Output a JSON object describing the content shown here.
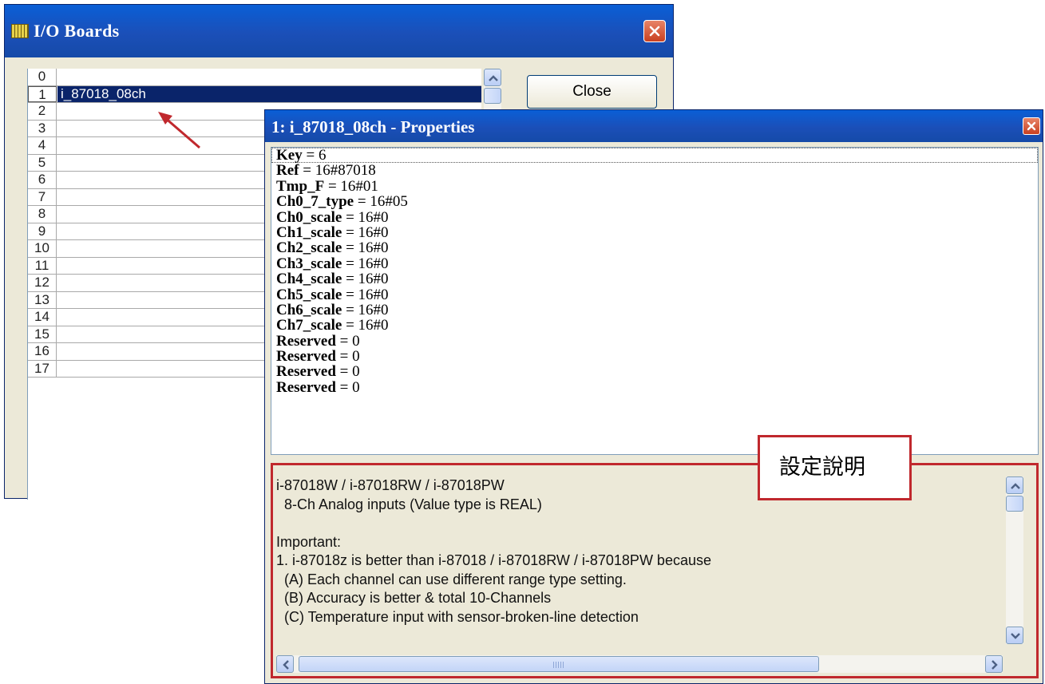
{
  "io_window": {
    "title": "I/O Boards",
    "close_label": "Close",
    "rows": [
      {
        "num": "0",
        "name": ""
      },
      {
        "num": "1",
        "name": "i_87018_08ch",
        "selected": true
      },
      {
        "num": "2",
        "name": ""
      },
      {
        "num": "3",
        "name": ""
      },
      {
        "num": "4",
        "name": ""
      },
      {
        "num": "5",
        "name": ""
      },
      {
        "num": "6",
        "name": ""
      },
      {
        "num": "7",
        "name": ""
      },
      {
        "num": "8",
        "name": ""
      },
      {
        "num": "9",
        "name": ""
      },
      {
        "num": "10",
        "name": ""
      },
      {
        "num": "11",
        "name": ""
      },
      {
        "num": "12",
        "name": ""
      },
      {
        "num": "13",
        "name": ""
      },
      {
        "num": "14",
        "name": ""
      },
      {
        "num": "15",
        "name": ""
      },
      {
        "num": "16",
        "name": ""
      },
      {
        "num": "17",
        "name": ""
      }
    ]
  },
  "properties_window": {
    "title": "1: i_87018_08ch - Properties",
    "properties": [
      {
        "key": "Key",
        "value": "6"
      },
      {
        "key": "Ref",
        "value": "16#87018"
      },
      {
        "key": "Tmp_F",
        "value": "16#01"
      },
      {
        "key": "Ch0_7_type",
        "value": "16#05"
      },
      {
        "key": "Ch0_scale",
        "value": "16#0"
      },
      {
        "key": "Ch1_scale",
        "value": "16#0"
      },
      {
        "key": "Ch2_scale",
        "value": "16#0"
      },
      {
        "key": "Ch3_scale",
        "value": "16#0"
      },
      {
        "key": "Ch4_scale",
        "value": "16#0"
      },
      {
        "key": "Ch5_scale",
        "value": "16#0"
      },
      {
        "key": "Ch6_scale",
        "value": "16#0"
      },
      {
        "key": "Ch7_scale",
        "value": "16#0"
      },
      {
        "key": "Reserved",
        "value": "0"
      },
      {
        "key": "Reserved",
        "value": "0"
      },
      {
        "key": "Reserved",
        "value": "0"
      },
      {
        "key": "Reserved",
        "value": "0"
      }
    ],
    "description_lines": [
      "i-87018W / i-87018RW / i-87018PW",
      "  8-Ch Analog inputs (Value type is REAL)",
      "",
      "Important:",
      "1. i-87018z is better than i-87018 / i-87018RW / i-87018PW because",
      "  (A) Each channel can use different range type setting.",
      "  (B) Accuracy is better & total 10-Channels",
      "  (C) Temperature input with sensor-broken-line detection"
    ]
  },
  "annotation": {
    "callout_text": "設定說明",
    "highlight_color": "#c0282d"
  },
  "colors": {
    "titlebar": "#0a5fd6",
    "selection": "#0a246a",
    "window_bg": "#ece9d8"
  }
}
